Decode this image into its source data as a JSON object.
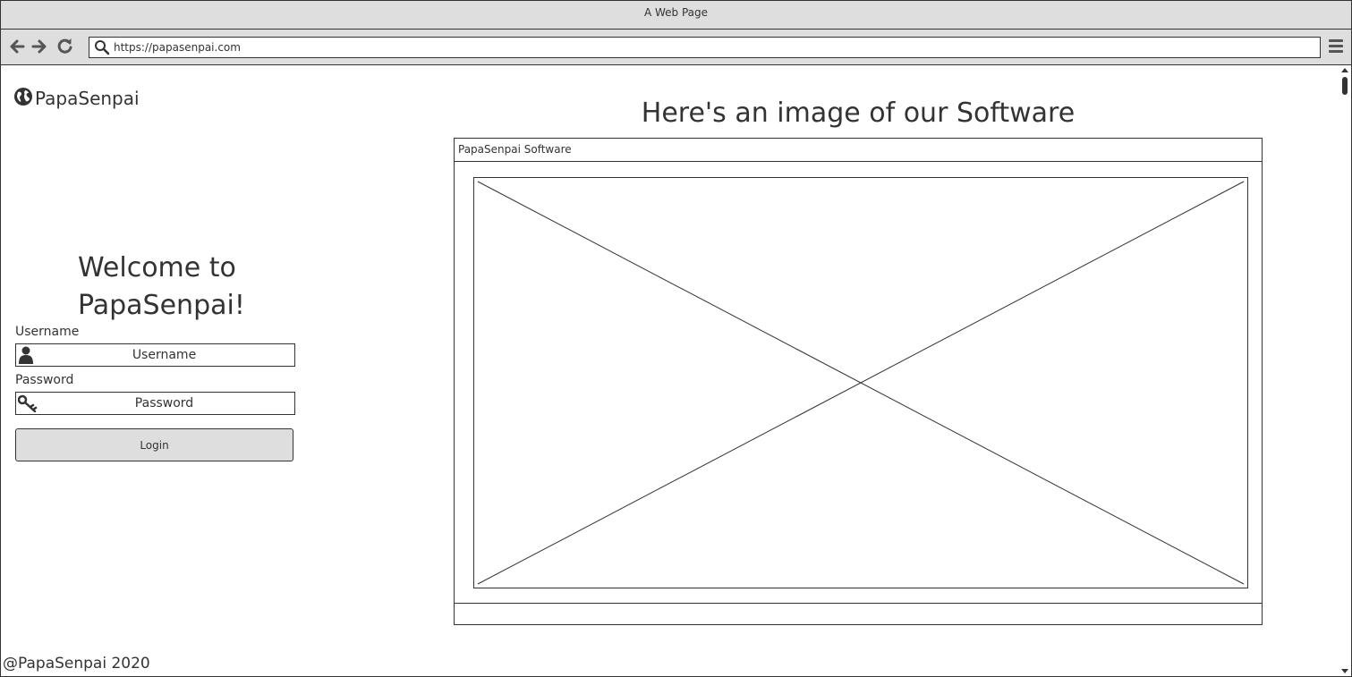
{
  "browser": {
    "window_title": "A Web Page",
    "url": "https://papasenpai.com",
    "back_icon": "arrow-left",
    "forward_icon": "arrow-right",
    "reload_icon": "reload",
    "menu_icon": "hamburger-menu"
  },
  "header": {
    "logo_icon": "globe",
    "brand": "PapaSenpai"
  },
  "login": {
    "welcome_line1": "Welcome to",
    "welcome_line2": "PapaSenpai!",
    "username_label": "Username",
    "username_placeholder": "Username",
    "username_icon": "user",
    "password_label": "Password",
    "password_placeholder": "Password",
    "password_icon": "key",
    "login_button": "Login"
  },
  "showcase": {
    "heading": "Here's an image of our Software",
    "window_title": "PapaSenpai Software"
  },
  "footer": {
    "copyright": "@PapaSenpai 2020"
  },
  "colors": {
    "chrome": "#dedede",
    "stroke": "#333333",
    "background": "#ffffff"
  }
}
